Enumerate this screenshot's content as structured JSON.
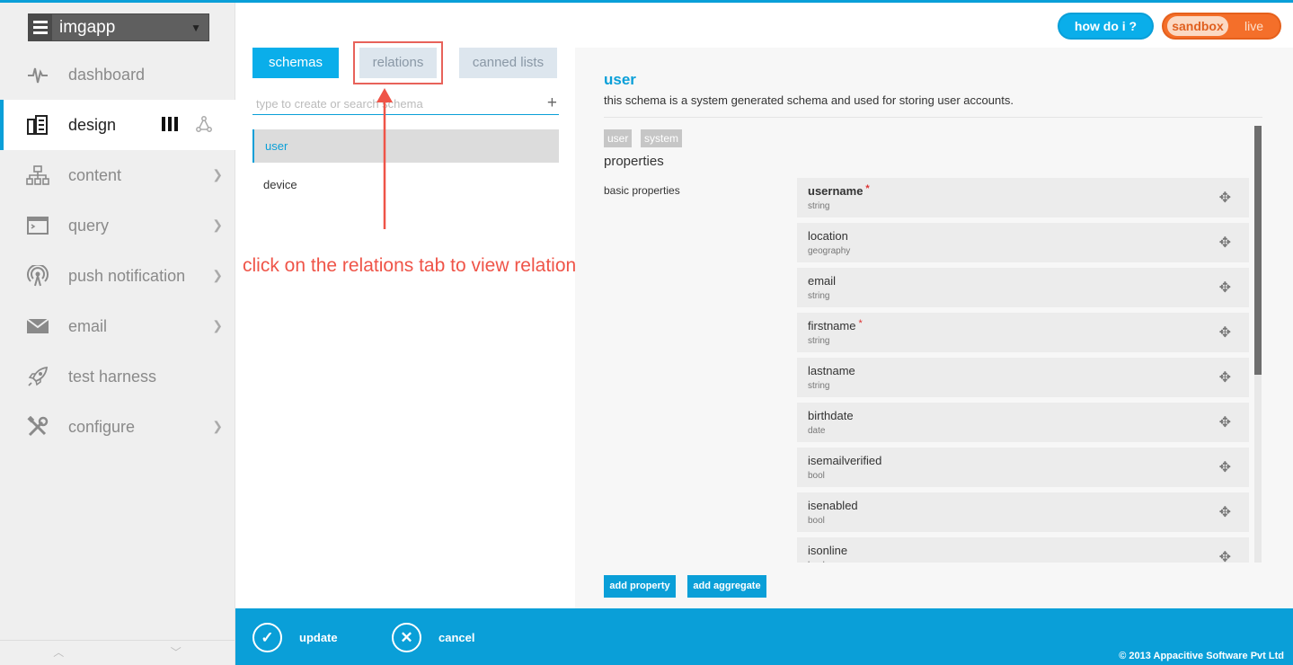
{
  "app": {
    "name": "imgapp"
  },
  "nav": {
    "items": [
      {
        "label": "dashboard",
        "icon": "pulse-icon"
      },
      {
        "label": "design",
        "icon": "design-icon",
        "active": true
      },
      {
        "label": "content",
        "icon": "sitemap-icon",
        "chevron": true
      },
      {
        "label": "query",
        "icon": "terminal-icon",
        "chevron": true
      },
      {
        "label": "push notification",
        "icon": "broadcast-icon",
        "chevron": true
      },
      {
        "label": "email",
        "icon": "envelope-icon",
        "chevron": true
      },
      {
        "label": "test harness",
        "icon": "rocket-icon"
      },
      {
        "label": "configure",
        "icon": "tools-icon",
        "chevron": true
      }
    ]
  },
  "topbar": {
    "help_label": "how do i ?",
    "env_sandbox": "sandbox",
    "env_live": "live"
  },
  "tabs": {
    "schemas": "schemas",
    "relations": "relations",
    "canned": "canned lists"
  },
  "search": {
    "placeholder": "type to create or search schema",
    "value": ""
  },
  "schemas": {
    "items": [
      "user",
      "device"
    ],
    "selected": "user"
  },
  "annotation": {
    "text": "click on the relations tab to view relations",
    "color": "#ef5448"
  },
  "detail": {
    "title": "user",
    "description": "this schema is a system generated schema and used for storing user accounts.",
    "tags": [
      "user",
      "system"
    ],
    "properties_title": "properties",
    "basic_label": "basic properties",
    "properties": [
      {
        "name": "username",
        "type": "string",
        "required": true
      },
      {
        "name": "location",
        "type": "geography",
        "required": false
      },
      {
        "name": "email",
        "type": "string",
        "required": false
      },
      {
        "name": "firstname",
        "type": "string",
        "required": true
      },
      {
        "name": "lastname",
        "type": "string",
        "required": false
      },
      {
        "name": "birthdate",
        "type": "date",
        "required": false
      },
      {
        "name": "isemailverified",
        "type": "bool",
        "required": false
      },
      {
        "name": "isenabled",
        "type": "bool",
        "required": false
      },
      {
        "name": "isonline",
        "type": "bool",
        "required": false
      }
    ],
    "add_property": "add property",
    "add_aggregate": "add aggregate"
  },
  "footer": {
    "update": "update",
    "cancel": "cancel",
    "copyright": "© 2013 Appacitive Software Pvt Ltd"
  },
  "colors": {
    "accent": "#0a9fd8",
    "live_toggle": "#f46f2a",
    "annotation": "#ef5448"
  }
}
